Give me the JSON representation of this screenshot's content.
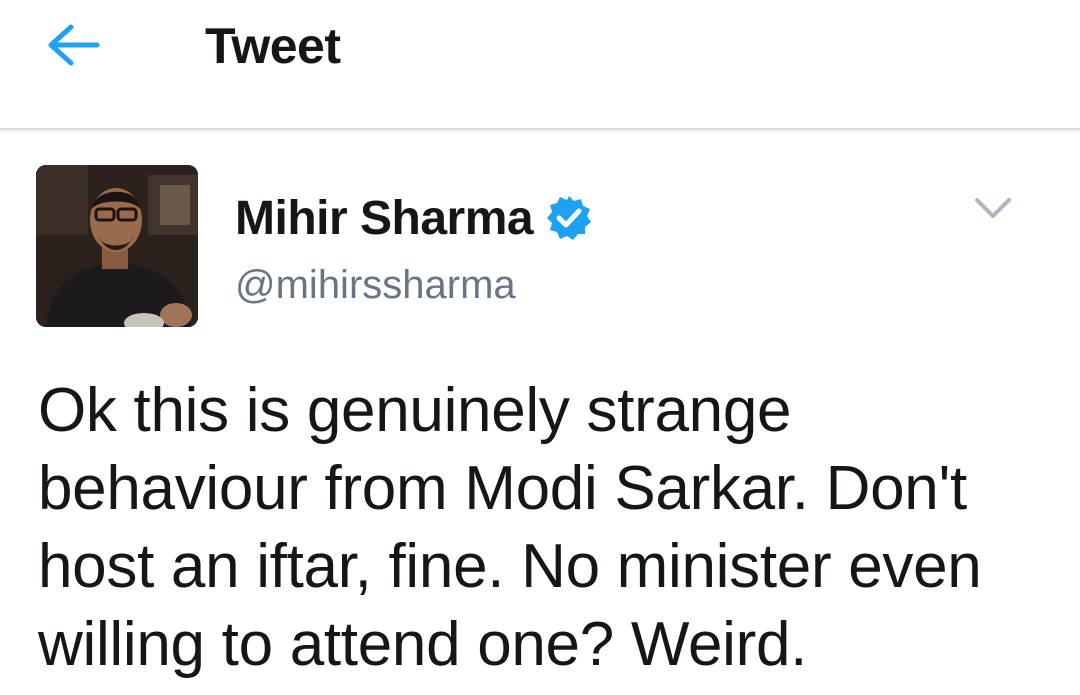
{
  "header": {
    "title": "Tweet",
    "back_icon": "arrow-left-icon",
    "accent_color": "#1da1f2"
  },
  "tweet": {
    "author": {
      "name": "Mihir Sharma",
      "handle": "@mihirssharma",
      "verified": true,
      "verified_icon": "verified-badge-icon"
    },
    "menu_icon": "chevron-down-icon",
    "text": "Ok this is genuinely strange behaviour from Modi Sarkar. Don't host an iftar, fine. No minister even willing to attend one? Weird."
  },
  "colors": {
    "text_primary": "#14171a",
    "text_secondary": "#657786",
    "verified_blue": "#1da1f2",
    "divider": "#d7dbdf"
  }
}
